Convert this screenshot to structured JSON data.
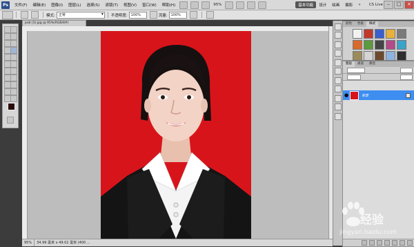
{
  "menubar": {
    "logo": "Ps",
    "menus": [
      "文件(F)",
      "编辑(E)",
      "图像(I)",
      "图层(L)",
      "选择(S)",
      "滤镜(T)",
      "视图(V)",
      "窗口(W)",
      "帮助(H)"
    ],
    "zoom": "95%",
    "workspaces": [
      "基本功能",
      "设计",
      "绘画",
      "摄影"
    ],
    "cs_live": "CS Live"
  },
  "options": {
    "mode_label": "模式:",
    "mode_value": "正常",
    "opacity_label": "不透明度:",
    "opacity_value": "100%",
    "flow_label": "流量:",
    "flow_value": "100%"
  },
  "document": {
    "tab_title": "pob (3).jpg @ 95%(RGB/8#)",
    "status_zoom": "95%",
    "status_info": "34.99 毫米 x 49.02 毫米 (400 ..."
  },
  "styles_panel": {
    "tabs": [
      "颜色",
      "色板",
      "样式"
    ],
    "swatch_colors": [
      "#f2f2f2",
      "#c0392b",
      "#3a5fcd",
      "#e8b13c",
      "#7a7a7a",
      "#d96a2b",
      "#5b9b3d",
      "#444444",
      "#b34a8a",
      "#3aa3c9",
      "#9c8b5a",
      "#d4d4d4",
      "#6b4a2e",
      "#8fb3e0",
      "#2e2e2e",
      "#c9c9a2",
      "#a0a0a0",
      "#4a6a9a",
      "#e0e0e0",
      "#7b2f2f",
      "#c7a04a"
    ]
  },
  "layers_panel": {
    "tabs": [
      "图层",
      "通道",
      "路径"
    ],
    "layer_name": "背景"
  },
  "watermark": {
    "brand": "经验",
    "url": "jingyan.baidu.com"
  }
}
